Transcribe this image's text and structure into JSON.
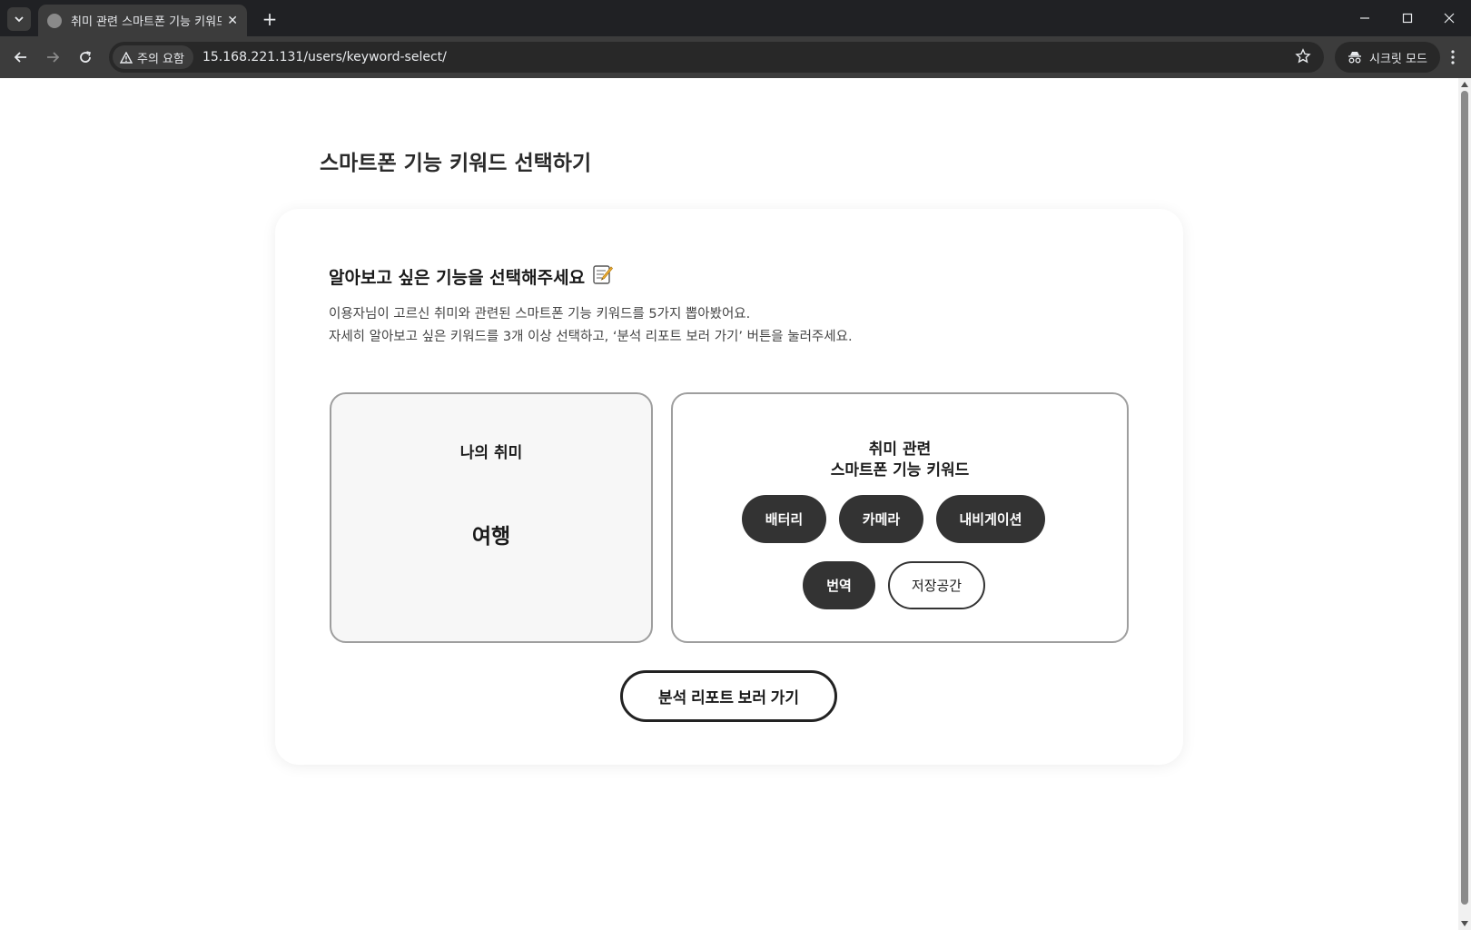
{
  "browser": {
    "tab_title": "취미 관련 스마트폰 기능 키워드",
    "security_label": "주의 요함",
    "url": "15.168.221.131/users/keyword-select/",
    "incognito_label": "시크릿 모드"
  },
  "page": {
    "title": "스마트폰 기능 키워드 선택하기",
    "card": {
      "heading": "알아보고 싶은 기능을 선택해주세요",
      "desc_line1": "이용자님이 고르신 취미와 관련된 스마트폰 기능 키워드를 5가지 뽑아봤어요.",
      "desc_line2": "자세히 알아보고 싶은 키워드를 3개 이상 선택하고, ‘분석 리포트 보러 가기’ 버튼을 눌러주세요."
    },
    "hobby": {
      "label": "나의 취미",
      "value": "여행"
    },
    "keywords": {
      "title_line1": "취미 관련",
      "title_line2": "스마트폰 기능 키워드",
      "items": [
        {
          "label": "배터리",
          "selected": true
        },
        {
          "label": "카메라",
          "selected": true
        },
        {
          "label": "내비게이션",
          "selected": true
        },
        {
          "label": "번역",
          "selected": true
        },
        {
          "label": "저장공간",
          "selected": false
        }
      ]
    },
    "submit_label": "분석 리포트 보러 가기"
  },
  "colors": {
    "chip_selected_bg": "#333333",
    "chrome_dark": "#202124",
    "chrome_toolbar": "#3c3c3c"
  }
}
